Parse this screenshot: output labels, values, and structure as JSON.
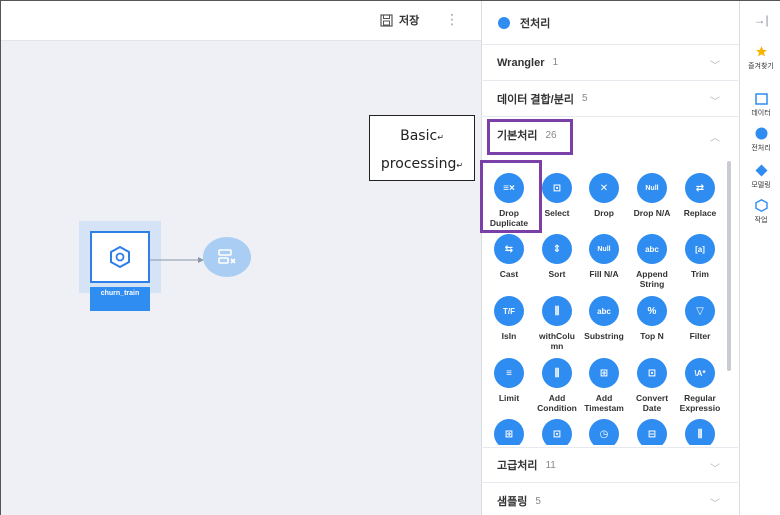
{
  "toolbar": {
    "save_label": "저장",
    "more_label": "⋮"
  },
  "canvas": {
    "source_node_label": "churn_train",
    "callout_line1": "Basic",
    "callout_line2": "processing",
    "callout_mark": "↵"
  },
  "panel": {
    "header": "전처리",
    "sections": [
      {
        "title": "Wrangler",
        "count": "1"
      },
      {
        "title": "데이터 결합/분리",
        "count": "5"
      },
      {
        "title": "기본처리",
        "count": "26"
      },
      {
        "title": "고급처리",
        "count": "11"
      },
      {
        "title": "샘플링",
        "count": "5"
      }
    ],
    "tools": [
      {
        "label": "Drop Duplicate",
        "icon": "drop-duplicate-icon",
        "glyph": "≡×"
      },
      {
        "label": "Select",
        "icon": "select-icon",
        "glyph": "⊡"
      },
      {
        "label": "Drop",
        "icon": "drop-icon",
        "glyph": "✕"
      },
      {
        "label": "Drop N/A",
        "icon": "drop-na-icon",
        "glyph": "Null"
      },
      {
        "label": "Replace",
        "icon": "replace-icon",
        "glyph": "⇄"
      },
      {
        "label": "Cast",
        "icon": "cast-icon",
        "glyph": "⇆"
      },
      {
        "label": "Sort",
        "icon": "sort-icon",
        "glyph": "⇕"
      },
      {
        "label": "Fill N/A",
        "icon": "fill-na-icon",
        "glyph": "Null"
      },
      {
        "label": "Append String",
        "icon": "append-string-icon",
        "glyph": "abc"
      },
      {
        "label": "Trim",
        "icon": "trim-icon",
        "glyph": "[a]"
      },
      {
        "label": "IsIn",
        "icon": "isin-icon",
        "glyph": "T/F"
      },
      {
        "label": "withColumn",
        "icon": "with-column-icon",
        "glyph": "⫼"
      },
      {
        "label": "Substring",
        "icon": "substring-icon",
        "glyph": "abc"
      },
      {
        "label": "Top N",
        "icon": "top-n-icon",
        "glyph": "%"
      },
      {
        "label": "Filter",
        "icon": "filter-icon",
        "glyph": "▽"
      },
      {
        "label": "Limit",
        "icon": "limit-icon",
        "glyph": "≡"
      },
      {
        "label": "Add Condition",
        "icon": "add-condition-icon",
        "glyph": "⫼"
      },
      {
        "label": "Add Timestam",
        "icon": "add-timestamp-icon",
        "glyph": "⊞"
      },
      {
        "label": "Convert Date",
        "icon": "convert-date-icon",
        "glyph": "⊡"
      },
      {
        "label": "Regular Expressio",
        "icon": "regex-icon",
        "glyph": "\\A*"
      },
      {
        "label": "",
        "icon": "date-icon",
        "glyph": "⊞"
      },
      {
        "label": "",
        "icon": "calendar-icon",
        "glyph": "⊡"
      },
      {
        "label": "",
        "icon": "clock-icon",
        "glyph": "◷"
      },
      {
        "label": "",
        "icon": "split-icon",
        "glyph": "⊟"
      },
      {
        "label": "",
        "icon": "column-icon",
        "glyph": "⫼"
      }
    ]
  },
  "rail": {
    "collapse_label": "→|",
    "items": [
      {
        "label": "즐겨찾기",
        "icon": "star-icon"
      },
      {
        "label": "데이터",
        "icon": "data-icon"
      },
      {
        "label": "전처리",
        "icon": "preprocess-icon"
      },
      {
        "label": "모델링",
        "icon": "modeling-icon"
      },
      {
        "label": "작업",
        "icon": "task-icon"
      }
    ]
  },
  "colors": {
    "accent": "#2f8cf0",
    "highlight": "#7b3fa8",
    "canvas_bg": "#eef0f5"
  }
}
